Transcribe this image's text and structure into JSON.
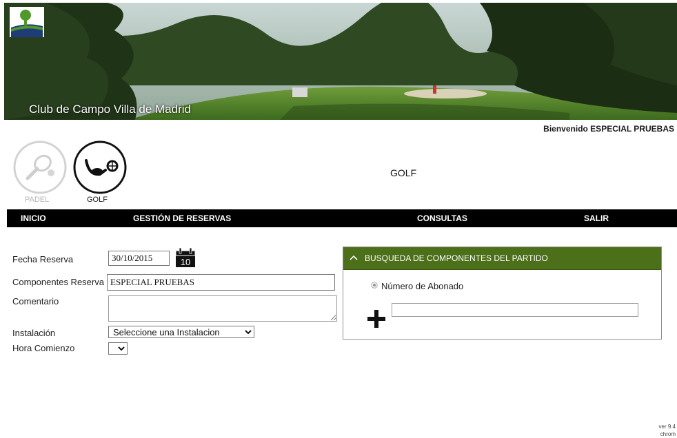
{
  "header": {
    "club_name": "Club de Campo Villa de Madrid",
    "welcome": "Bienvenido ESPECIAL PRUEBAS"
  },
  "sports": [
    {
      "label": "PADEL",
      "icon": "padel-racket-icon",
      "active": false
    },
    {
      "label": "GOLF",
      "icon": "golf-club-icon",
      "active": true
    }
  ],
  "section_title": "GOLF",
  "nav": {
    "inicio": "INICIO",
    "gestion": "GESTIÓN DE RESERVAS",
    "consultas": "CONSULTAS",
    "salir": "SALIR"
  },
  "form": {
    "fecha_label": "Fecha Reserva",
    "fecha_value": "30/10/2015",
    "calendar_day": "10",
    "componentes_label": "Componentes Reserva",
    "componentes_value": "ESPECIAL PRUEBAS",
    "comentario_label": "Comentario",
    "comentario_value": "",
    "instalacion_label": "Instalación",
    "instalacion_selected": "Seleccione una Instalacion",
    "hora_label": "Hora Comienzo",
    "hora_selected": ""
  },
  "search_panel": {
    "title": "BUSQUEDA DE COMPONENTES DEL PARTIDO",
    "radio_label": "Número de Abonado",
    "input_value": ""
  },
  "footer": {
    "version": "ver 9.4",
    "browser": "chrom"
  },
  "colors": {
    "panel_header": "#4c6f1a",
    "navbar": "#000000",
    "logo_green": "#4f9a2a",
    "logo_blue": "#1e3c7a"
  }
}
